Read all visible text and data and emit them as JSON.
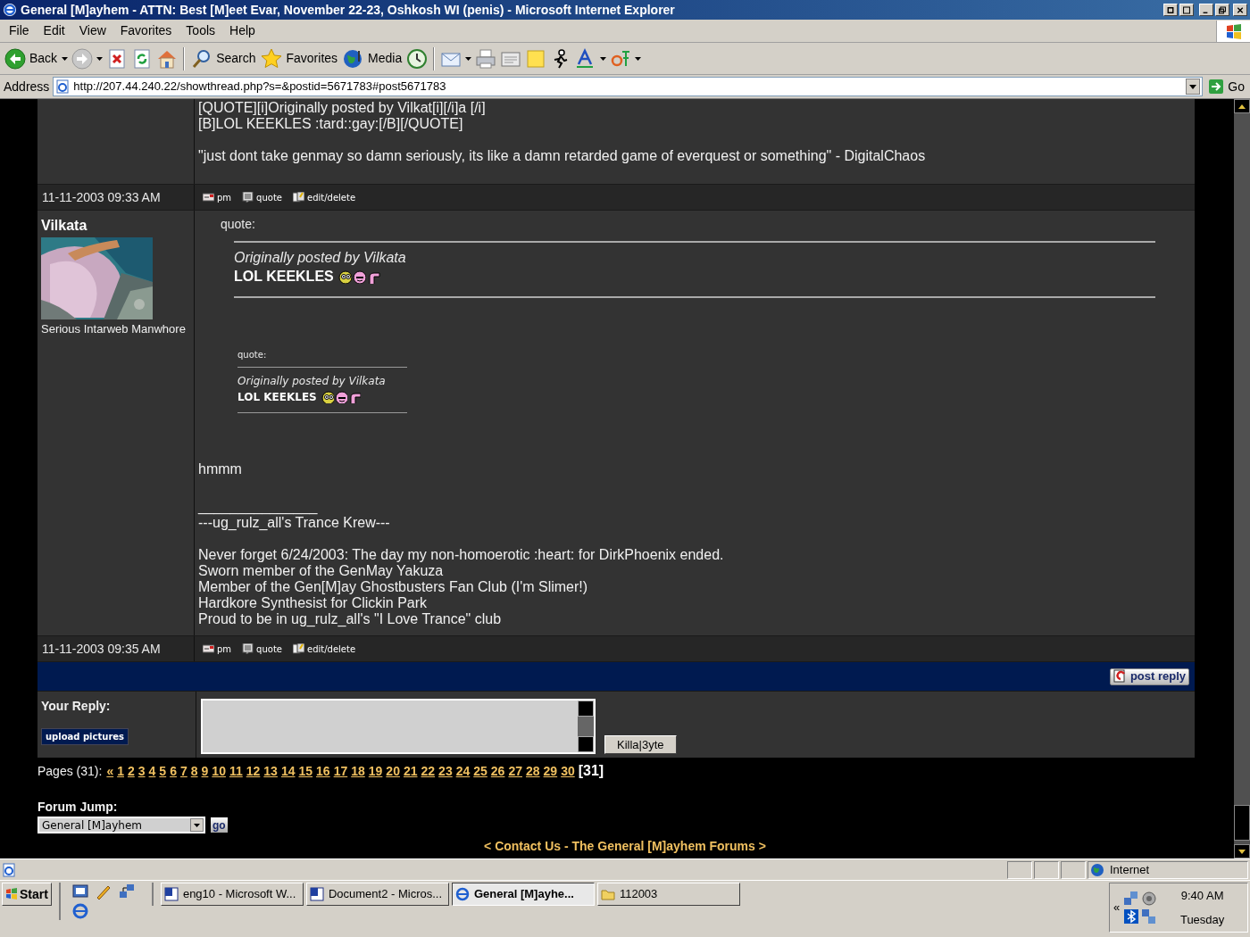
{
  "window": {
    "title": "General [M]ayhem - ATTN: Best [M]eet Evar, November 22-23, Oshkosh WI (penis) - Microsoft Internet Explorer"
  },
  "menu": [
    "File",
    "Edit",
    "View",
    "Favorites",
    "Tools",
    "Help"
  ],
  "toolbar": [
    {
      "kind": "back",
      "label": "Back",
      "menu": true
    },
    {
      "kind": "forward",
      "menu": true
    },
    {
      "kind": "stop",
      "menu": false
    },
    {
      "kind": "refresh",
      "menu": false
    },
    {
      "kind": "home",
      "menu": false
    },
    {
      "kind": "separator"
    },
    {
      "kind": "search",
      "label": "Search",
      "menu": false
    },
    {
      "kind": "favorites",
      "label": "Favorites",
      "menu": false
    },
    {
      "kind": "media",
      "label": "Media",
      "menu": false
    },
    {
      "kind": "history",
      "menu": false
    },
    {
      "kind": "separator"
    },
    {
      "kind": "mail",
      "menu": true
    },
    {
      "kind": "print",
      "menu": false
    },
    {
      "kind": "edit",
      "menu": false
    },
    {
      "kind": "discuss",
      "menu": false
    },
    {
      "kind": "messenger",
      "menu": false
    },
    {
      "kind": "font",
      "menu": true
    },
    {
      "kind": "translate",
      "menu": true
    }
  ],
  "address": {
    "label": "Address",
    "url": "http://207.44.240.22/showthread.php?s=&postid=5671783#post5671783",
    "go": "Go"
  },
  "posts": [
    {
      "body": [
        [
          "[QUOTE][i]Originally posted by Vilkat[i][/i]a [/i]",
          "[B]LOL KEEKLES :tard::gay:[/B][/QUOTE]"
        ],
        [
          "\"just dont take genmay so damn seriously, its like a damn retarded game of everquest or something\" - DigitalChaos"
        ]
      ],
      "date": "11-11-2003 09:33 AM",
      "actions": [
        {
          "kind": "pm",
          "label": "pm"
        },
        {
          "kind": "quote",
          "label": "quote"
        },
        {
          "kind": "edit",
          "label": "edit/delete"
        }
      ]
    },
    {
      "author": "Vilkata",
      "avatar": {
        "kind": "picture"
      },
      "user_title": "Serious Intarweb Manwhore",
      "quotes": [
        {
          "kind": "full",
          "heading": "quote:",
          "byline": "Originally posted by Vilkata",
          "text": "LOL KEEKLES"
        },
        {
          "kind": "nested",
          "heading": "quote:",
          "byline": "Originally posted by Vilkata",
          "text": "LOL KEEKLES"
        }
      ],
      "body": [
        [
          "hmmm"
        ]
      ],
      "signature_rule": "_______________",
      "signature": [
        [
          "---ug_rulz_all's Trance Krew---"
        ],
        [
          "Never forget 6/24/2003: The day my non-homoerotic :heart: for DirkPhoenix ended.",
          "Sworn member of the GenMay Yakuza",
          "Member of the Gen[M]ay Ghostbusters Fan Club (I'm Slimer!)",
          "Hardkore Synthesist for Clickin Park",
          "Proud to be in ug_rulz_all's \"I Love Trance\" club"
        ]
      ],
      "date": "11-11-2003 09:35 AM",
      "actions": [
        {
          "kind": "pm",
          "label": "pm"
        },
        {
          "kind": "quote",
          "label": "quote"
        },
        {
          "kind": "edit",
          "label": "edit/delete"
        }
      ]
    }
  ],
  "post_reply": "post reply",
  "reply": {
    "label": "Your Reply:",
    "upload": "upload pictures",
    "submit": "Killa|3yte"
  },
  "pages": {
    "label": "Pages (31):",
    "links": [
      {
        "label": "«",
        "selected": false
      },
      {
        "label": "1",
        "selected": false
      },
      {
        "label": "2",
        "selected": false
      },
      {
        "label": "3",
        "selected": false
      },
      {
        "label": "4",
        "selected": false
      },
      {
        "label": "5",
        "selected": false
      },
      {
        "label": "6",
        "selected": false
      },
      {
        "label": "7",
        "selected": false
      },
      {
        "label": "8",
        "selected": false
      },
      {
        "label": "9",
        "selected": false
      },
      {
        "label": "10",
        "selected": false
      },
      {
        "label": "11",
        "selected": false
      },
      {
        "label": "12",
        "selected": false
      },
      {
        "label": "13",
        "selected": false
      },
      {
        "label": "14",
        "selected": false
      },
      {
        "label": "15",
        "selected": false
      },
      {
        "label": "16",
        "selected": false
      },
      {
        "label": "17",
        "selected": false
      },
      {
        "label": "18",
        "selected": false
      },
      {
        "label": "19",
        "selected": false
      },
      {
        "label": "20",
        "selected": false
      },
      {
        "label": "21",
        "selected": false
      },
      {
        "label": "22",
        "selected": false
      },
      {
        "label": "23",
        "selected": false
      },
      {
        "label": "24",
        "selected": false
      },
      {
        "label": "25",
        "selected": false
      },
      {
        "label": "26",
        "selected": false
      },
      {
        "label": "27",
        "selected": false
      },
      {
        "label": "28",
        "selected": false
      },
      {
        "label": "29",
        "selected": false
      },
      {
        "label": "30",
        "selected": false
      },
      {
        "label": "[31]",
        "selected": true
      }
    ]
  },
  "forum_jump": {
    "label": "Forum Jump:",
    "value": "General [M]ayhem",
    "go": "go"
  },
  "footer": "< Contact Us - The General [M]ayhem Forums >",
  "status_bar": {
    "zone": "Internet"
  },
  "taskbar": {
    "start": "Start",
    "tasks": [
      {
        "kind": "word",
        "label": "eng10 - Microsoft W...",
        "selected": false
      },
      {
        "kind": "word",
        "label": "Document2 - Micros...",
        "selected": false
      },
      {
        "kind": "browser",
        "label": "General [M]ayhe...",
        "selected": true
      },
      {
        "kind": "folder",
        "label": "112003",
        "selected": false
      }
    ],
    "tray_toggle": "«",
    "time": "9:40 AM",
    "day": "Tuesday"
  }
}
